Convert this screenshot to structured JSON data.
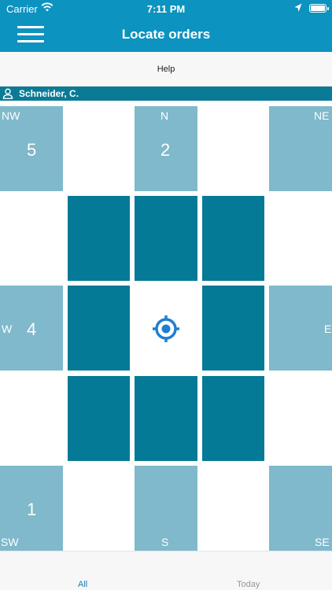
{
  "status": {
    "carrier": "Carrier",
    "time": "7:11 PM"
  },
  "header": {
    "title": "Locate orders"
  },
  "help": {
    "label": "Help"
  },
  "user": {
    "name": "Schneider, C."
  },
  "sectors": {
    "nw": {
      "label": "NW",
      "count": "5"
    },
    "n": {
      "label": "N",
      "count": "2"
    },
    "ne": {
      "label": "NE"
    },
    "w": {
      "label": "W",
      "count": "4"
    },
    "e": {
      "label": "E"
    },
    "sw": {
      "label": "SW",
      "count": "1"
    },
    "s": {
      "label": "S"
    },
    "se": {
      "label": "SE"
    }
  },
  "tabs": {
    "all": "All",
    "today": "Today"
  },
  "colors": {
    "accent": "#0c93c0",
    "sector_light": "#7fb9cb",
    "sector_dark": "#057a96",
    "target": "#1f7fd1"
  },
  "icons": [
    "wifi-icon",
    "location-arrow-icon",
    "battery-icon",
    "hamburger-menu-icon",
    "user-icon",
    "crosshair-icon"
  ]
}
